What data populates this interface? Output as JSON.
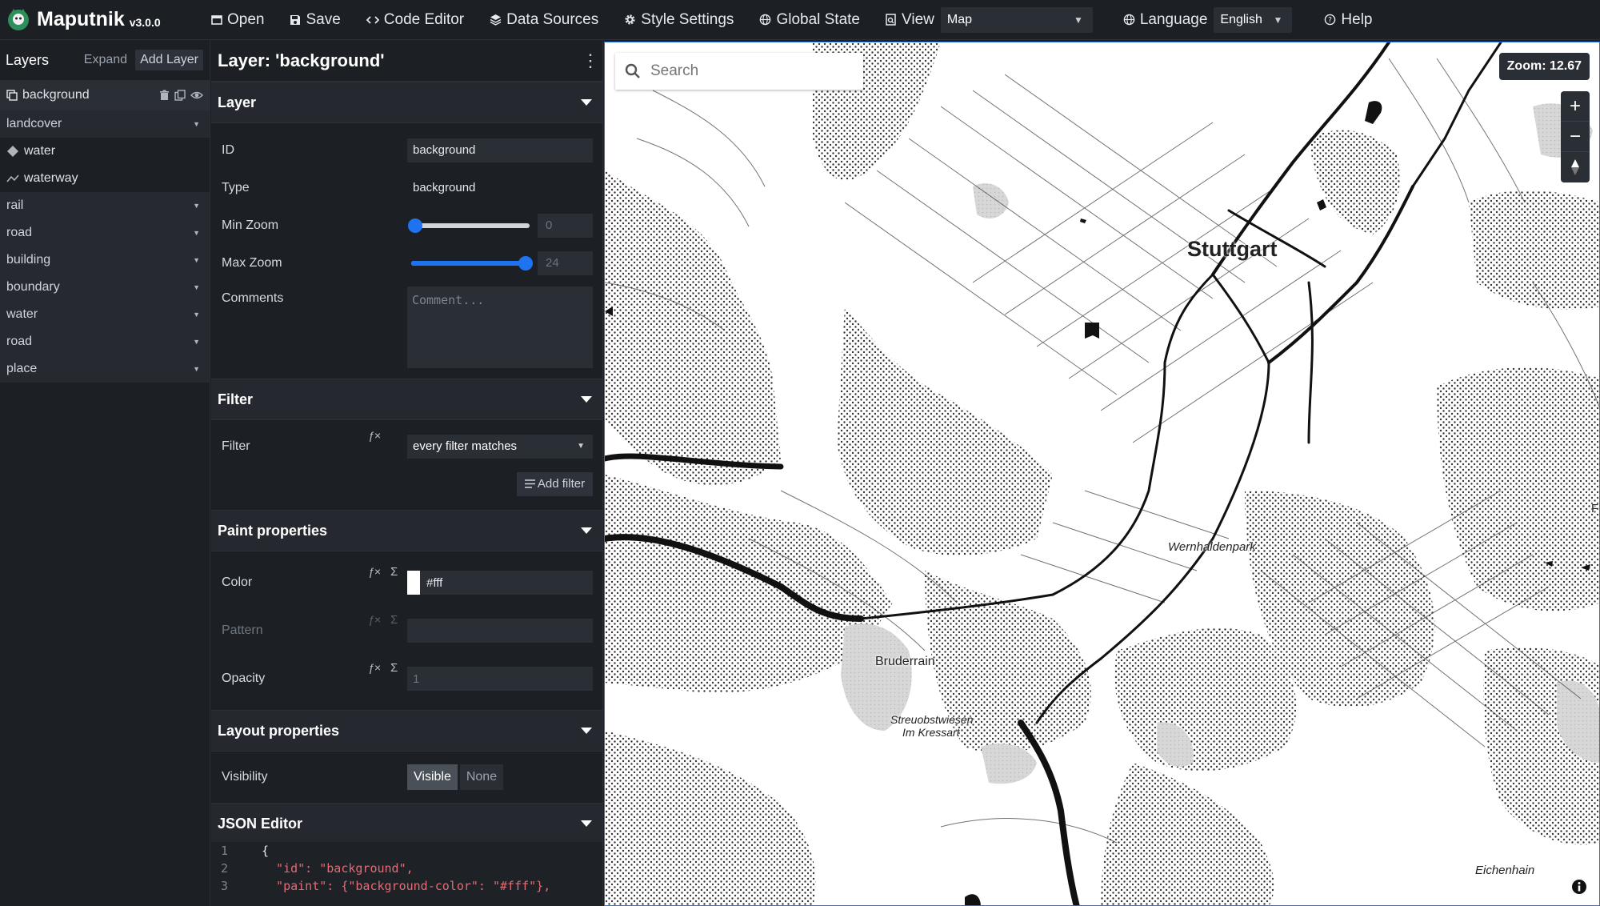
{
  "app": {
    "name": "Maputnik",
    "version": "v3.0.0"
  },
  "toolbar": {
    "open": "Open",
    "save": "Save",
    "code_editor": "Code Editor",
    "data_sources": "Data Sources",
    "style_settings": "Style Settings",
    "global_state": "Global State",
    "view": "View",
    "view_value": "Map",
    "language": "Language",
    "language_value": "English",
    "help": "Help"
  },
  "layers_panel": {
    "title": "Layers",
    "expand": "Expand",
    "add_layer": "Add Layer",
    "items": [
      {
        "label": "background",
        "kind": "layer",
        "icon": "background-icon",
        "active": true
      },
      {
        "label": "landcover",
        "kind": "group"
      },
      {
        "label": "water",
        "kind": "layer",
        "icon": "fill-icon"
      },
      {
        "label": "waterway",
        "kind": "layer",
        "icon": "line-icon"
      },
      {
        "label": "rail",
        "kind": "group"
      },
      {
        "label": "road",
        "kind": "group"
      },
      {
        "label": "building",
        "kind": "group"
      },
      {
        "label": "boundary",
        "kind": "group"
      },
      {
        "label": "water",
        "kind": "group"
      },
      {
        "label": "road",
        "kind": "group"
      },
      {
        "label": "place",
        "kind": "group"
      }
    ]
  },
  "editor": {
    "title": "Layer: 'background'",
    "layer_section": {
      "title": "Layer",
      "id_label": "ID",
      "id_value": "background",
      "type_label": "Type",
      "type_value": "background",
      "min_zoom_label": "Min Zoom",
      "min_zoom_value": "0",
      "min_zoom_level": 0,
      "max_zoom_label": "Max Zoom",
      "max_zoom_value": "24",
      "max_zoom_level": 24,
      "comments_label": "Comments",
      "comments_placeholder": "Comment..."
    },
    "filter_section": {
      "title": "Filter",
      "filter_label": "Filter",
      "filter_value": "every filter matches",
      "add_filter": "Add filter"
    },
    "paint_section": {
      "title": "Paint properties",
      "color_label": "Color",
      "color_value": "#fff",
      "pattern_label": "Pattern",
      "pattern_value": "",
      "opacity_label": "Opacity",
      "opacity_value": "1"
    },
    "layout_section": {
      "title": "Layout properties",
      "visibility_label": "Visibility",
      "visible": "Visible",
      "none": "None"
    },
    "json_section": {
      "title": "JSON Editor",
      "lines": [
        {
          "n": "1",
          "text": "{"
        },
        {
          "n": "2",
          "text": "  \"id\": \"background\","
        },
        {
          "n": "3",
          "text": "  \"paint\": {\"background-color\": \"#fff\"},"
        }
      ]
    }
  },
  "map": {
    "search_placeholder": "Search",
    "zoom_label": "Zoom: 12.67",
    "labels": {
      "stuttgart": "Stuttgart",
      "wernhaldenpark": "Wernhaldenpark",
      "bruderrain": "Bruderrain",
      "streuobst1": "Streuobstwiesen",
      "streuobst2": "Im Kressart",
      "eichenhain": "Eichenhain",
      "edge_f": "F"
    }
  },
  "colors": {
    "accent": "#1e73f0",
    "panel": "#1c1f24",
    "field": "#2a2e35"
  }
}
